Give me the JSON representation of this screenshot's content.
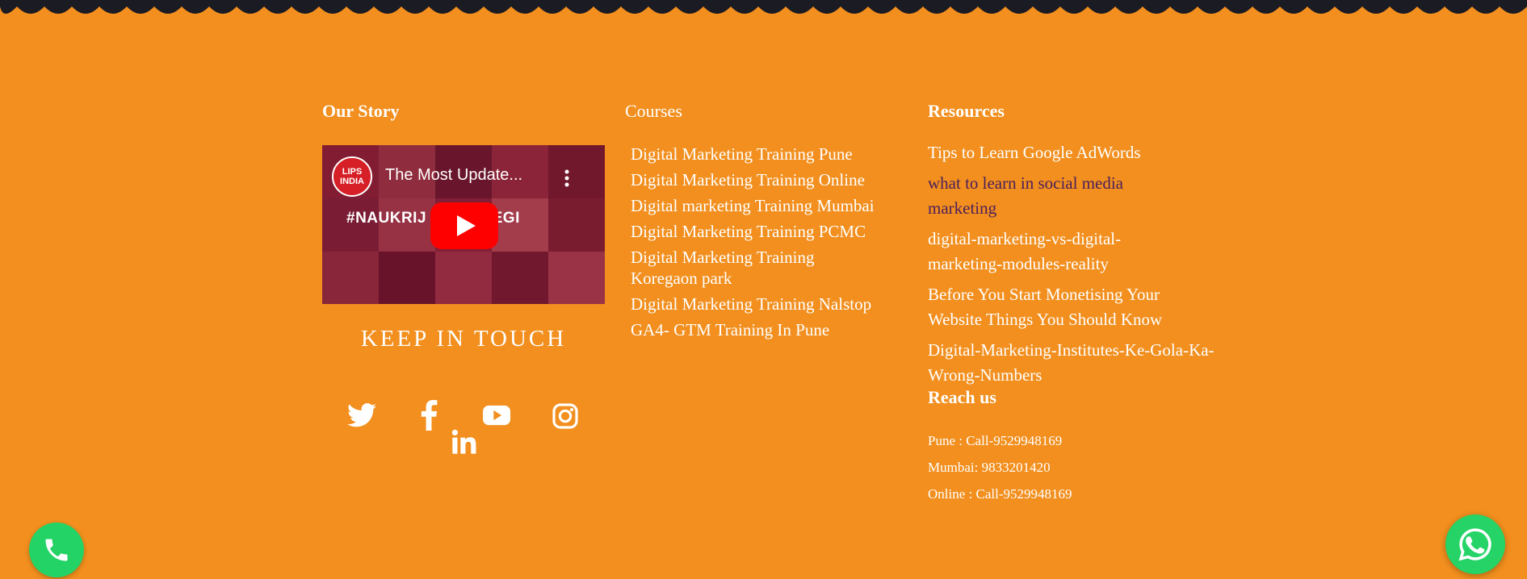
{
  "colors": {
    "background": "#f28f1e",
    "wave": "#1b1b24",
    "link_visited": "#4b1f5a",
    "fab": "#25d366"
  },
  "our_story": {
    "heading": "Our Story",
    "video": {
      "badge": "LIPS INDIA",
      "title": "The Most Update...",
      "banner": "#NAUKRIJ          RKEMILEGI",
      "play_icon": "youtube-play-icon"
    },
    "keep_in_touch": "KEEP IN TOUCH",
    "social_icons": [
      "twitter-icon",
      "facebook-icon",
      "youtube-icon",
      "instagram-icon",
      "linkedin-icon"
    ]
  },
  "courses": {
    "heading": "Courses",
    "items": [
      "Digital Marketing Training Pune",
      "Digital Marketing Training Online",
      "Digital marketing Training Mumbai",
      "Digital Marketing Training PCMC",
      "Digital Marketing Training Koregaon park",
      "Digital Marketing Training Nalstop",
      "GA4- GTM Training In Pune"
    ]
  },
  "resources": {
    "heading": "Resources",
    "items": [
      "Tips to Learn Google AdWords",
      "what to learn in social media marketing",
      "digital-marketing-vs-digital-marketing-modules-reality",
      "Before You Start Monetising Your Website Things You Should Know",
      "Digital-Marketing-Institutes-Ke-Gola-Ka-Wrong-Numbers"
    ]
  },
  "reach_us": {
    "heading": "Reach us",
    "items": [
      "Pune : Call-9529948169",
      "Mumbai: 9833201420",
      "Online : Call-9529948169"
    ]
  },
  "floating": {
    "phone_icon": "phone-icon",
    "whatsapp_icon": "whatsapp-icon"
  }
}
